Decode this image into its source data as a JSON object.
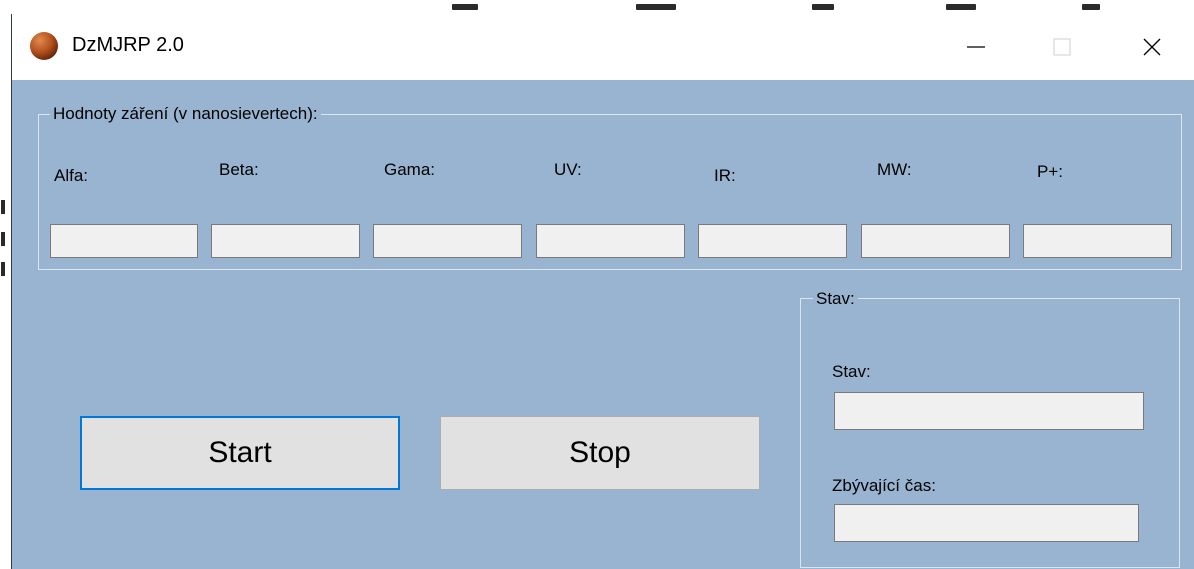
{
  "window": {
    "title": "DzMJRP 2.0"
  },
  "titlebar_buttons": {
    "minimize_icon": "minimize-icon",
    "maximize_icon": "maximize-icon",
    "close_icon": "close-icon"
  },
  "radiation_group": {
    "legend": "Hodnoty záření (v nanosievertech):",
    "fields": [
      {
        "label": "Alfa:",
        "value": ""
      },
      {
        "label": "Beta:",
        "value": ""
      },
      {
        "label": "Gama:",
        "value": ""
      },
      {
        "label": "UV:",
        "value": ""
      },
      {
        "label": "IR:",
        "value": ""
      },
      {
        "label": "MW:",
        "value": ""
      },
      {
        "label": "P+:",
        "value": ""
      }
    ]
  },
  "buttons": {
    "start": "Start",
    "stop": "Stop"
  },
  "status_group": {
    "legend": "Stav:",
    "status_label": "Stav:",
    "status_value": "",
    "remaining_label": "Zbývající čas:",
    "remaining_value": ""
  },
  "colors": {
    "client_bg": "#99b4d1",
    "focus": "#0078d7"
  }
}
